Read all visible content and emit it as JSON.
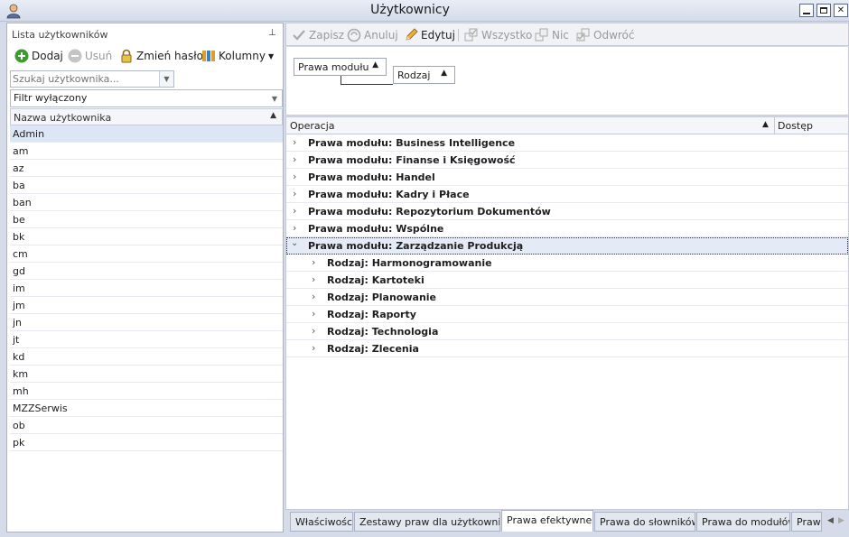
{
  "window": {
    "title": "Użytkownicy"
  },
  "left": {
    "header": "Lista użytkowników",
    "toolbar": {
      "add": "Dodaj",
      "remove": "Usuń",
      "change_password": "Zmień hasło",
      "columns": "Kolumny"
    },
    "search_placeholder": "Szukaj użytkownika...",
    "filter": "Filtr wyłączony",
    "column_header": "Nazwa użytkownika",
    "users": [
      "Admin",
      "am",
      "az",
      "ba",
      "ban",
      "be",
      "bk",
      "cm",
      "gd",
      "im",
      "jm",
      "jn",
      "jt",
      "kd",
      "km",
      "mh",
      "MZZSerwis",
      "ob",
      "pk"
    ]
  },
  "right": {
    "toolbar": {
      "save": "Zapisz",
      "cancel": "Anuluj",
      "edit": "Edytuj",
      "all": "Wszystko",
      "none": "Nic",
      "invert": "Odwróć"
    },
    "group": {
      "level1": "Prawa modułu",
      "level2": "Rodzaj"
    },
    "columns": {
      "operation": "Operacja",
      "access": "Dostęp"
    },
    "rows": [
      "Prawa modułu: Business Intelligence",
      "Prawa modułu: Finanse i Księgowość",
      "Prawa modułu: Handel",
      "Prawa modułu: Kadry i Płace",
      "Prawa modułu: Repozytorium Dokumentów",
      "Prawa modułu: Wspólne",
      "Prawa modułu: Zarządzanie Produkcją",
      "Rodzaj: Harmonogramowanie",
      "Rodzaj: Kartoteki",
      "Rodzaj: Planowanie",
      "Rodzaj: Raporty",
      "Rodzaj: Technologia",
      "Rodzaj: Zlecenia"
    ],
    "tabs": [
      "Właściwości",
      "Zestawy praw dla użytkownika",
      "Prawa efektywne",
      "Prawa do słowników",
      "Prawa do modułów",
      "Praw"
    ]
  },
  "icons": {
    "app": "user-icon",
    "add": "plus-circle-icon",
    "remove": "minus-circle-icon",
    "password": "lock-icon",
    "columns": "columns-icon",
    "save": "check-icon",
    "cancel": "cancel-icon",
    "edit": "pencil-icon",
    "all": "check-all-icon",
    "none": "check-none-icon",
    "invert": "invert-icon"
  },
  "colors": {
    "accent": "#3c9a2e",
    "selection": "#dde6f4"
  }
}
